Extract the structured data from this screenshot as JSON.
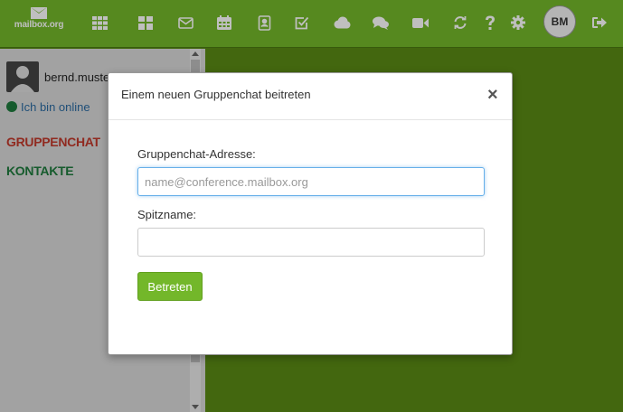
{
  "brand": {
    "logo_text": "mailbox.org"
  },
  "toolbar": {
    "icons": [
      "apps-grid-icon",
      "portal-icon",
      "mail-icon",
      "calendar-icon",
      "contacts-icon",
      "tasks-icon",
      "cloud-icon",
      "chat-icon",
      "video-icon",
      "refresh-icon",
      "help-icon",
      "settings-icon",
      "logout-icon"
    ],
    "user_initials": "BM"
  },
  "sidebar": {
    "user_name": "bernd.muste",
    "status": "Ich bin online",
    "groups": [
      {
        "label": "GRUPPENCHAT",
        "color": "#c0392b"
      },
      {
        "label": "KONTAKTE",
        "color": "#1e7a3c"
      }
    ]
  },
  "dialog": {
    "title": "Einem neuen Gruppenchat beitreten",
    "close": "×",
    "address_label": "Gruppenchat-Adresse:",
    "address_placeholder": "name@conference.mailbox.org",
    "address_value": "",
    "nickname_label": "Spitzname:",
    "nickname_value": "",
    "join_button": "Betreten"
  },
  "colors": {
    "accent": "#73b72a",
    "background": "#5a8a14",
    "sidebar": "#d9d9d9"
  }
}
